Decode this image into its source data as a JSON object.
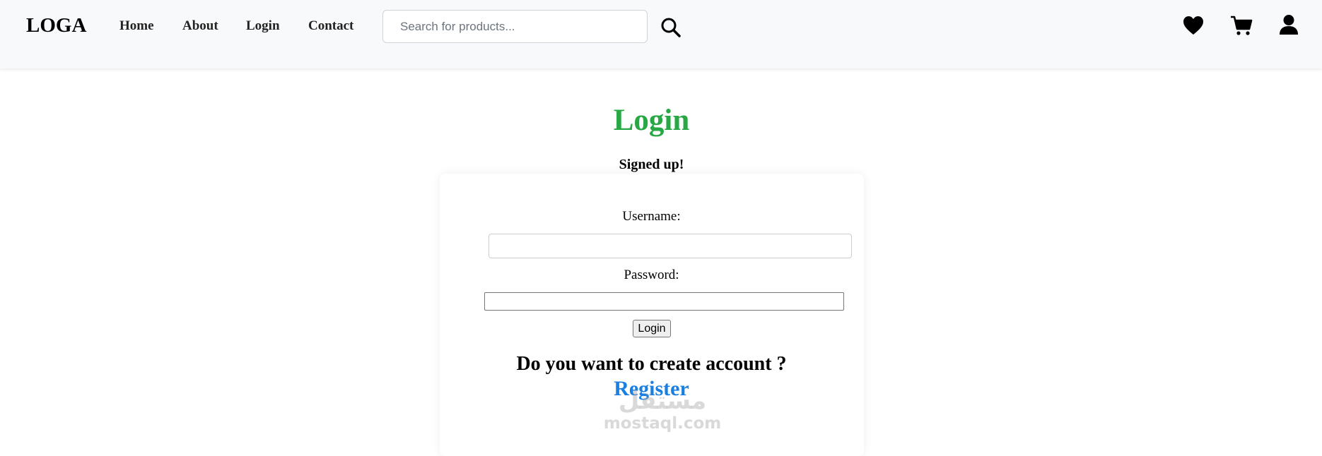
{
  "navbar": {
    "brand": "LOGA",
    "links": [
      {
        "label": "Home"
      },
      {
        "label": "About"
      },
      {
        "label": "Login"
      },
      {
        "label": "Contact"
      }
    ],
    "search": {
      "placeholder": "Search for products..."
    },
    "icons": [
      "search-icon",
      "heart-icon",
      "cart-icon",
      "user-icon"
    ]
  },
  "main": {
    "title": "Login",
    "status_message": "Signed up!",
    "form": {
      "username_label": "Username:",
      "username_value": "",
      "password_label": "Password:",
      "password_value": "",
      "submit_label": "Login"
    },
    "register_prompt": "Do you want to create account ?",
    "register_link": "Register"
  },
  "watermark": {
    "arabic": "مستقل",
    "text": "mostaql.com"
  },
  "colors": {
    "navbar_bg": "#f8f9fa",
    "title_green": "#28a745",
    "link_blue": "#1a7fe0"
  }
}
